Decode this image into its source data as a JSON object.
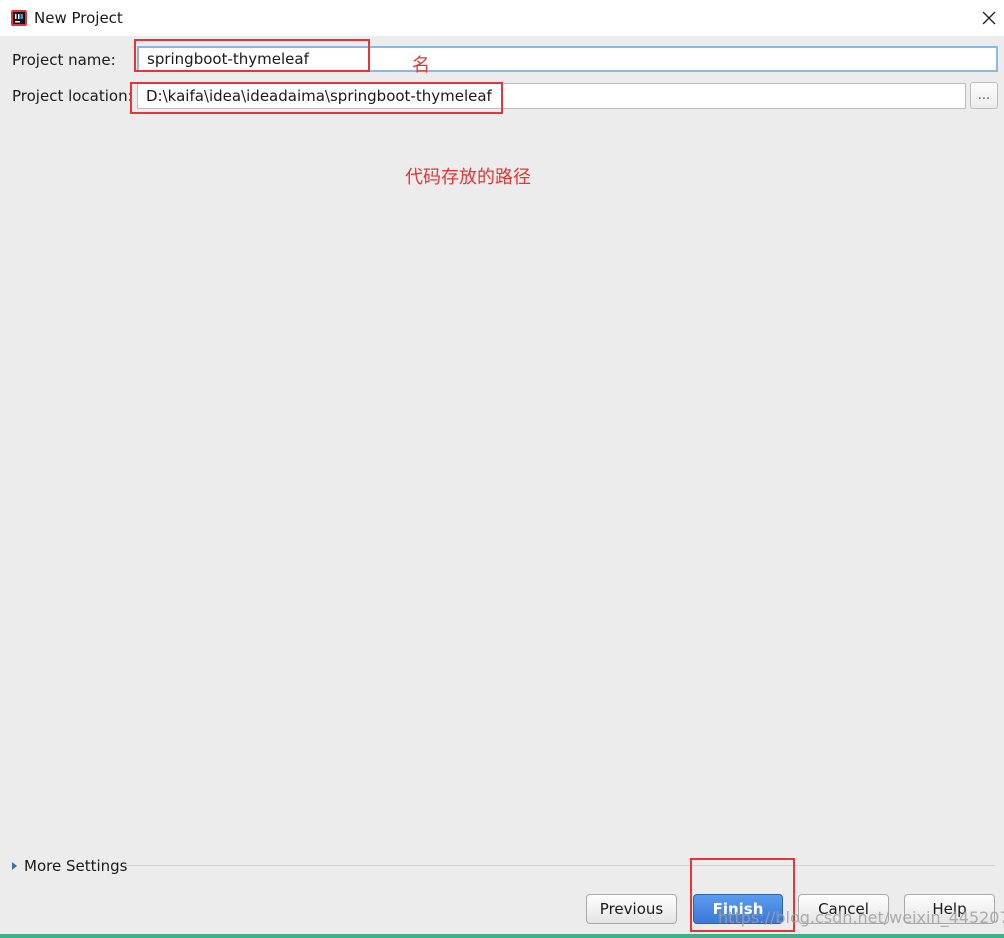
{
  "window": {
    "title": "New Project",
    "app_icon": "intellij-idea-icon",
    "close_icon": "close-icon"
  },
  "form": {
    "project_name_label": "Project name:",
    "project_name_value": "springboot-thymeleaf",
    "project_location_label": "Project location:",
    "project_location_value": "D:\\kaifa\\idea\\ideadaima\\springboot-thymeleaf",
    "browse_label": "..."
  },
  "annotations": {
    "name_note": "名",
    "location_note": "代码存放的路径",
    "color": "#e53535"
  },
  "more_settings": {
    "label": "More Settings"
  },
  "buttons": {
    "previous": "Previous",
    "finish": "Finish",
    "cancel": "Cancel",
    "help": "Help"
  },
  "watermark": "https://blog.csdn.net/weixin_44520739",
  "colors": {
    "accent": "#3c78d6",
    "focus_border": "#8cb6e6",
    "annotation": "#e53535"
  }
}
